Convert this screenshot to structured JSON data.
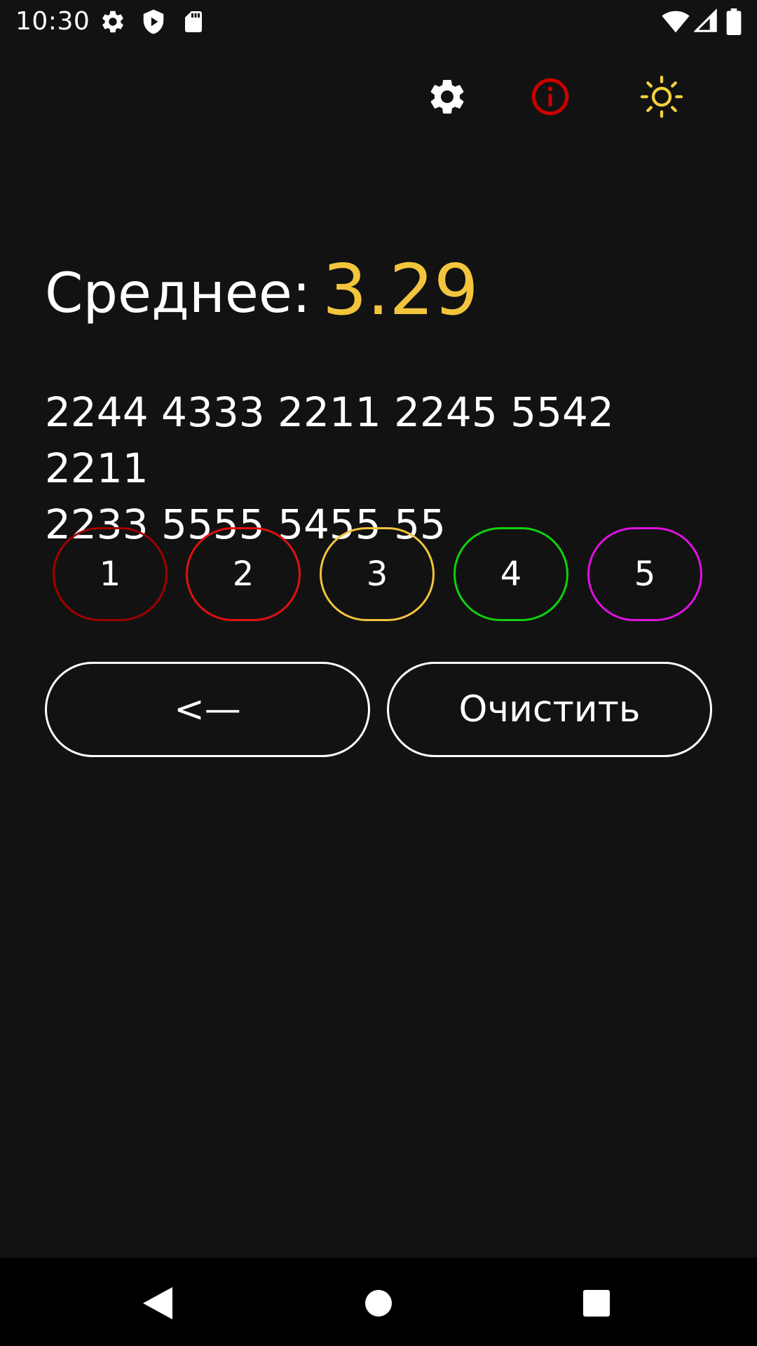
{
  "status_bar": {
    "time": "10:30",
    "left_icons": [
      "settings-icon",
      "shield-play-icon",
      "sd-card-icon"
    ],
    "right_icons": [
      "wifi-icon",
      "signal-icon",
      "battery-icon"
    ]
  },
  "toolbar": {
    "icons": [
      "gear-icon",
      "info-icon",
      "sun-icon"
    ],
    "colors": {
      "gear": "#ffffff",
      "info": "#cc0000",
      "sun": "#f2d13d"
    }
  },
  "average": {
    "label": "Среднее:",
    "value": "3.29",
    "value_color": "#f2c53d"
  },
  "grades": {
    "text": "2244 4333 2211 2245 5542 2211\n2233 5555 5455 55"
  },
  "grade_buttons": [
    {
      "label": "1",
      "color": "#a00000"
    },
    {
      "label": "2",
      "color": "#e01010"
    },
    {
      "label": "3",
      "color": "#f2c53d"
    },
    {
      "label": "4",
      "color": "#10d010"
    },
    {
      "label": "5",
      "color": "#e010e0"
    }
  ],
  "actions": {
    "backspace_label": "<—",
    "clear_label": "Очистить"
  },
  "nav_bar": {
    "icons": [
      "back-icon",
      "home-icon",
      "recents-icon"
    ]
  }
}
